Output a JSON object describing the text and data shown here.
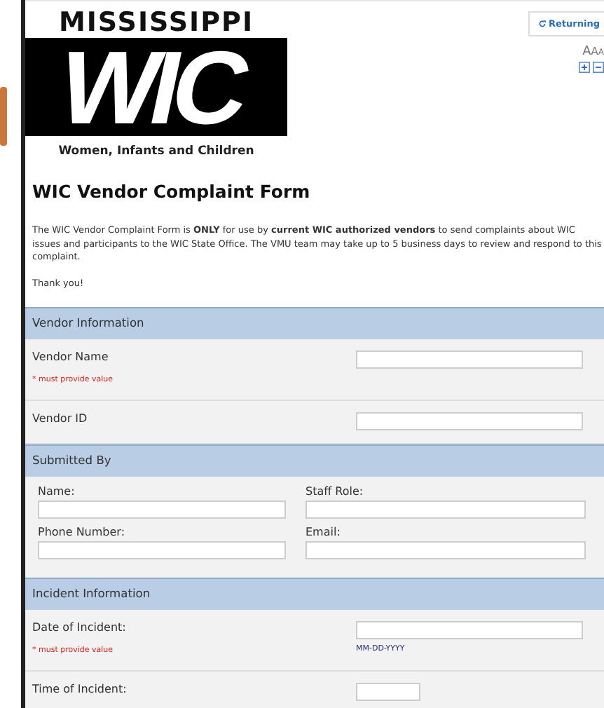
{
  "logo": {
    "top": "MISSISSIPPI",
    "big": "WIC",
    "bottom": "Women, Infants and Children"
  },
  "toolbar": {
    "returning": "Returning",
    "text_size": [
      "A",
      "A",
      "A"
    ]
  },
  "title": "WIC Vendor Complaint Form",
  "intro": "The WIC Vendor Complaint Form is **ONLY** for use by **current WIC authorized vendors** to send complaints about WIC issues and participants to the WIC State Office. The VMU team may take up to 5 business days to review and respond to this complaint.",
  "thanks": "Thank you!",
  "sections": [
    {
      "kind": "header",
      "label": "Vendor Information"
    },
    {
      "kind": "row",
      "label": "Vendor Name",
      "required": "* must provide value"
    },
    {
      "kind": "row",
      "label": "Vendor ID"
    },
    {
      "kind": "header",
      "label": "Submitted By"
    },
    {
      "kind": "grid",
      "fields": [
        "Name:",
        "Staff Role:",
        "Phone Number:",
        "Email:"
      ]
    },
    {
      "kind": "header",
      "label": "Incident Information"
    },
    {
      "kind": "row",
      "label": "Date of Incident:",
      "required": "* must provide value",
      "hint": "MM-DD-YYYY"
    },
    {
      "kind": "row",
      "label": "Time of Incident:",
      "short": true
    }
  ]
}
